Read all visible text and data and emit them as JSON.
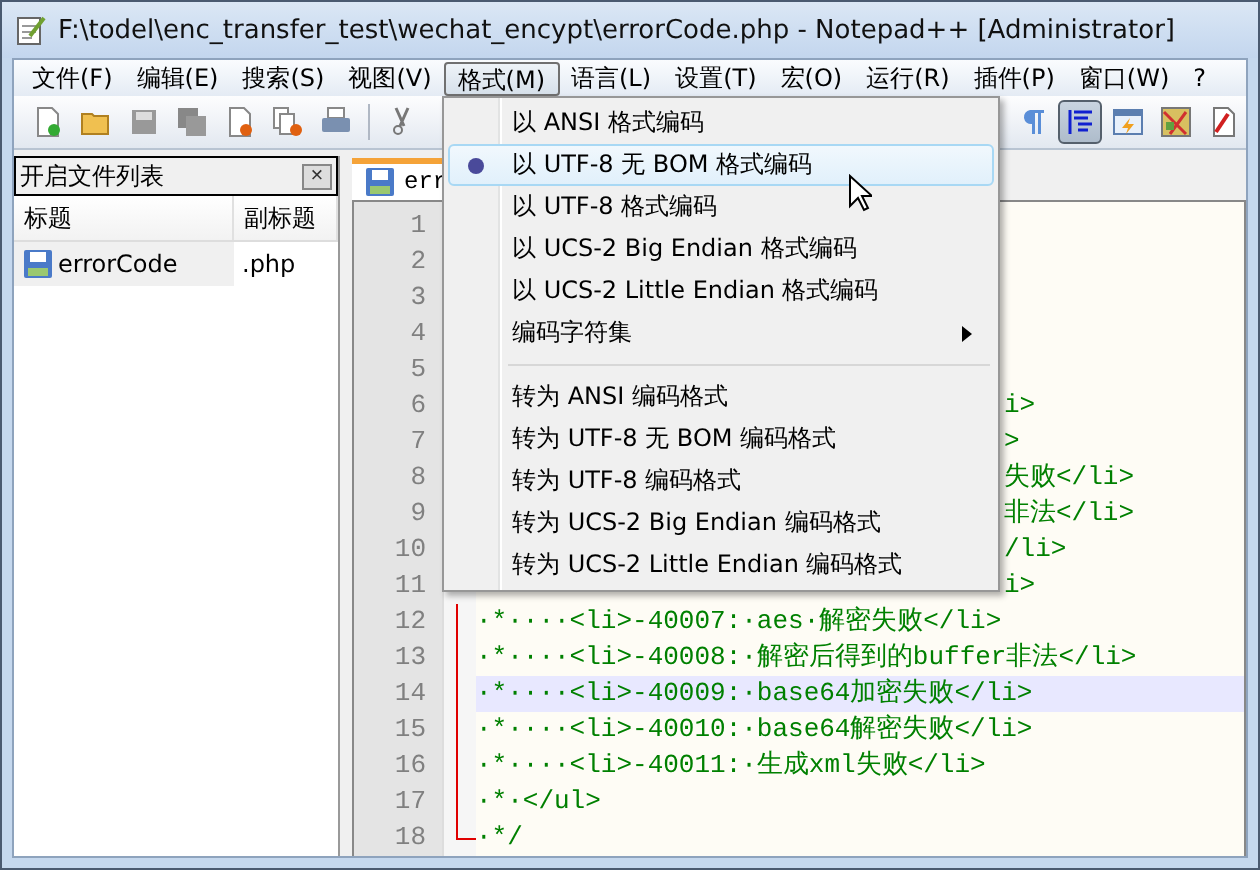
{
  "window": {
    "title": "F:\\todel\\enc_transfer_test\\wechat_encypt\\errorCode.php - Notepad++ [Administrator]"
  },
  "menu_bar": [
    {
      "label": "文件(F)",
      "selected": false
    },
    {
      "label": "编辑(E)",
      "selected": false
    },
    {
      "label": "搜索(S)",
      "selected": false
    },
    {
      "label": "视图(V)",
      "selected": false
    },
    {
      "label": "格式(M)",
      "selected": true
    },
    {
      "label": "语言(L)",
      "selected": false
    },
    {
      "label": "设置(T)",
      "selected": false
    },
    {
      "label": "宏(O)",
      "selected": false
    },
    {
      "label": "运行(R)",
      "selected": false
    },
    {
      "label": "插件(P)",
      "selected": false
    },
    {
      "label": "窗口(W)",
      "selected": false
    },
    {
      "label": "?",
      "selected": false
    }
  ],
  "toolbar_right": [
    {
      "kind": "pilcrow",
      "pressed": false
    },
    {
      "kind": "indent",
      "pressed": true
    },
    {
      "kind": "window",
      "pressed": false
    },
    {
      "kind": "map",
      "pressed": false
    },
    {
      "kind": "doc",
      "pressed": false
    }
  ],
  "file_list": {
    "title": "开启文件列表",
    "close": "×",
    "columns": [
      "标题",
      "副标题"
    ],
    "rows": [
      {
        "name": "errorCode",
        "ext": ".php"
      }
    ]
  },
  "tab": {
    "label": "err"
  },
  "format_menu": [
    {
      "kind": "item",
      "label": "以 ANSI 格式编码",
      "checked": false,
      "highlighted": false
    },
    {
      "kind": "item",
      "label": "以 UTF-8 无 BOM 格式编码",
      "checked": true,
      "highlighted": true
    },
    {
      "kind": "item",
      "label": "以 UTF-8 格式编码",
      "checked": false,
      "highlighted": false
    },
    {
      "kind": "item",
      "label": "以 UCS-2 Big Endian 格式编码",
      "checked": false,
      "highlighted": false
    },
    {
      "kind": "item",
      "label": "以 UCS-2 Little Endian 格式编码",
      "checked": false,
      "highlighted": false
    },
    {
      "kind": "submenu",
      "label": "编码字符集",
      "checked": false,
      "highlighted": false
    },
    {
      "kind": "separator"
    },
    {
      "kind": "item",
      "label": "转为 ANSI 编码格式",
      "checked": false,
      "highlighted": false
    },
    {
      "kind": "item",
      "label": "转为 UTF-8 无 BOM 编码格式",
      "checked": false,
      "highlighted": false
    },
    {
      "kind": "item",
      "label": "转为 UTF-8 编码格式",
      "checked": false,
      "highlighted": false
    },
    {
      "kind": "item",
      "label": "转为 UCS-2 Big Endian 编码格式",
      "checked": false,
      "highlighted": false
    },
    {
      "kind": "item",
      "label": "转为 UCS-2 Little Endian 编码格式",
      "checked": false,
      "highlighted": false
    }
  ],
  "editor": {
    "lines": [
      {
        "number": "1",
        "current": false
      },
      {
        "number": "2",
        "current": false
      },
      {
        "number": "3",
        "current": false
      },
      {
        "number": "4",
        "current": false
      },
      {
        "number": "5",
        "current": false
      },
      {
        "number": "6",
        "text": "i>",
        "current": false
      },
      {
        "number": "7",
        "text": ">",
        "current": false
      },
      {
        "number": "8",
        "text": "失败</li>",
        "current": false
      },
      {
        "number": "9",
        "text": "非法</li>",
        "current": false
      },
      {
        "number": "10",
        "text": "/li>",
        "current": false
      },
      {
        "number": "11",
        "text": "i>",
        "current": false
      },
      {
        "number": "12",
        "text": "·*····<li>-40007:·aes·解密失败</li>",
        "current": false
      },
      {
        "number": "13",
        "text": "·*····<li>-40008:·解密后得到的buffer非法</li>",
        "current": false
      },
      {
        "number": "14",
        "text": "·*····<li>-40009:·base64加密失败</li>",
        "current": true
      },
      {
        "number": "15",
        "text": "·*····<li>-40010:·base64解密失败</li>",
        "current": false
      },
      {
        "number": "16",
        "text": "·*····<li>-40011:·生成xml失败</li>",
        "current": false
      },
      {
        "number": "17",
        "text": "·*·</ul>",
        "current": false
      },
      {
        "number": "18",
        "text": "·*/",
        "current": false
      }
    ]
  }
}
